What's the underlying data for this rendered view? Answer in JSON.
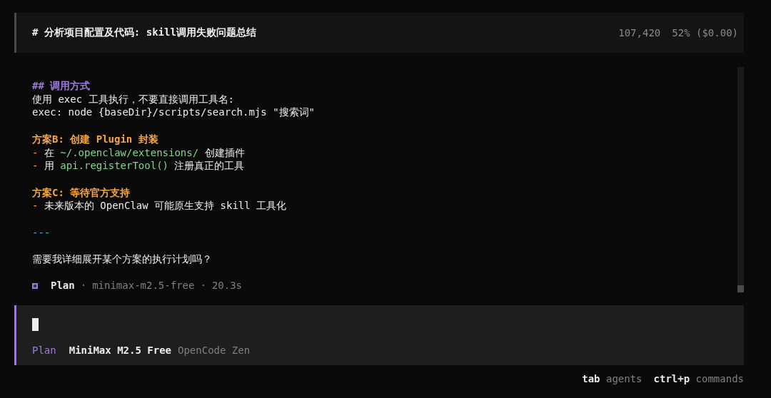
{
  "header": {
    "title": "# 分析项目配置及代码: skill调用失败问题总结",
    "tokens": "107,420",
    "usage": "52% ($0.00)"
  },
  "message": {
    "blocks": [
      {
        "lines": [
          {
            "segments": [
              {
                "text": "## 调用方式",
                "kind": "heading"
              }
            ]
          },
          {
            "segments": [
              {
                "text": "使用 exec 工具执行，不要直接调用工具名:",
                "kind": "text"
              }
            ]
          },
          {
            "segments": [
              {
                "text": "exec: node {baseDir}/scripts/search.mjs \"搜索词\"",
                "kind": "text"
              }
            ]
          }
        ]
      },
      {
        "lines": [
          {
            "segments": [
              {
                "text": "方案B: 创建 Plugin 封装",
                "kind": "subheading"
              }
            ]
          },
          {
            "segments": [
              {
                "text": "- ",
                "kind": "bullet"
              },
              {
                "text": "在 ",
                "kind": "text"
              },
              {
                "text": "~/.openclaw/extensions/",
                "kind": "code"
              },
              {
                "text": " 创建插件",
                "kind": "text"
              }
            ]
          },
          {
            "segments": [
              {
                "text": "- ",
                "kind": "bullet"
              },
              {
                "text": "用 ",
                "kind": "text"
              },
              {
                "text": "api.registerTool()",
                "kind": "code"
              },
              {
                "text": " 注册真正的工具",
                "kind": "text"
              }
            ]
          }
        ]
      },
      {
        "lines": [
          {
            "segments": [
              {
                "text": "方案C: 等待官方支持",
                "kind": "subheading"
              }
            ]
          },
          {
            "segments": [
              {
                "text": "- ",
                "kind": "bullet"
              },
              {
                "text": "未来版本的 OpenClaw 可能原生支持 skill 工具化",
                "kind": "text"
              }
            ]
          }
        ]
      },
      {
        "lines": [
          {
            "segments": [
              {
                "text": "---",
                "kind": "rule"
              }
            ]
          }
        ]
      },
      {
        "lines": [
          {
            "segments": [
              {
                "text": "需要我详细展开某个方案的执行计划吗？",
                "kind": "text"
              }
            ]
          }
        ]
      }
    ],
    "meta": {
      "agent": "Plan",
      "separator_1": "·",
      "model": "minimax-m2.5-free",
      "separator_2": "·",
      "duration": "20.3s"
    }
  },
  "input": {
    "agent": "Plan",
    "model": "MiniMax M2.5 Free",
    "provider": "OpenCode Zen"
  },
  "hints": [
    {
      "key": "tab",
      "label": "agents"
    },
    {
      "key": "ctrl+p",
      "label": "commands"
    }
  ]
}
